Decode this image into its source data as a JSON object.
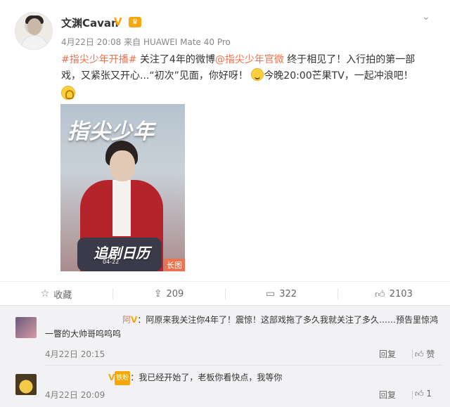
{
  "post": {
    "author": "文渊Cavan",
    "verified_mark": "V",
    "date": "4月22日 20:08",
    "source_prefix": "来自",
    "source": "HUAWEI Mate 40 Pro",
    "hashtag": "#指尖少年开播#",
    "text_1": "关注了4年的微博",
    "mention": "@指尖少年官微",
    "text_2": "终于相见了！入行拍的第一部戏，又紧张又开心...“初次”见面，你好呀！",
    "text_3": "今晚20:00芒果TV，一起冲浪吧！",
    "poster": {
      "title": "指尖少年",
      "sub": "追剧日历",
      "date": "04-22",
      "long_badge": "长图"
    }
  },
  "actions": {
    "favorite": "收藏",
    "repost": "209",
    "comment": "322",
    "like": "2103"
  },
  "comments": [
    {
      "user": "阿",
      "text": "：阿原来我关注你4年了！震惊！这部戏拖了多久我就关注了多久……预告里惊鸿一瞥的大帅哥呜呜呜",
      "time": "4月22日 20:15",
      "reply": "回复",
      "like": "赞"
    },
    {
      "user": "",
      "text": "：我已经开始了，老板你看快点，我等你",
      "time": "4月22日 20:09",
      "reply": "回复",
      "like": "1"
    }
  ],
  "icons": {
    "more": "chevron-down-icon",
    "favorite": "star-icon",
    "repost": "share-icon",
    "comment": "comment-icon",
    "like": "thumbs-up-icon"
  },
  "colors": {
    "accent": "#eb7350",
    "verified": "#f7a70a"
  }
}
